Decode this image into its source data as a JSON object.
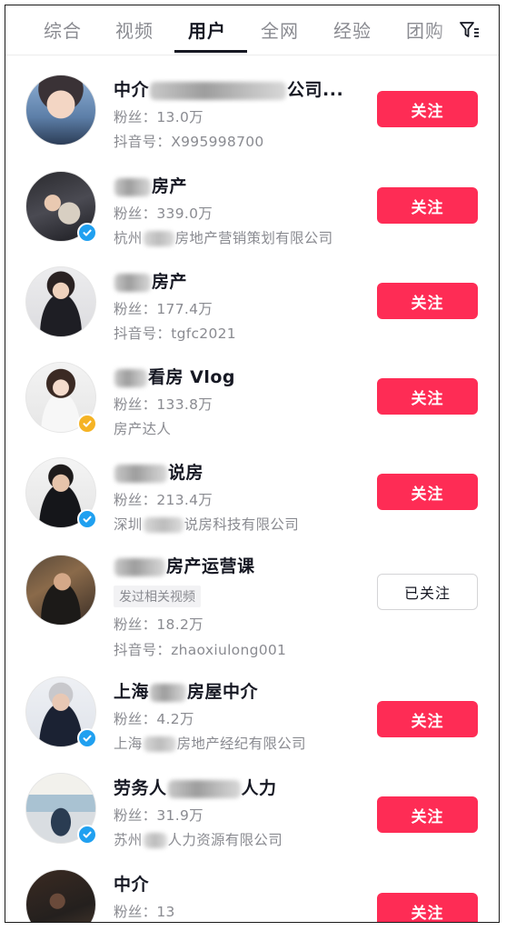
{
  "tabs": [
    {
      "label": "综合"
    },
    {
      "label": "视频"
    },
    {
      "label": "用户",
      "active": true
    },
    {
      "label": "全网"
    },
    {
      "label": "经验"
    },
    {
      "label": "团购"
    }
  ],
  "follow_label": "关注",
  "followed_label": "已关注",
  "users": [
    {
      "name_pre": "中介",
      "name_post": "公司...",
      "fans": "粉丝：13.0万",
      "sub_pre": "抖音号：X995998700",
      "sub_post": "",
      "verified": "none",
      "following": false
    },
    {
      "name_pre": "",
      "name_post": "房产",
      "fans": "粉丝：339.0万",
      "sub_pre": "杭州",
      "sub_post": "房地产营销策划有限公司",
      "verified": "blue",
      "following": false
    },
    {
      "name_pre": "",
      "name_post": "房产",
      "fans": "粉丝：177.4万",
      "sub_pre": "抖音号：tgfc2021",
      "sub_post": "",
      "verified": "none",
      "following": false
    },
    {
      "name_pre": "",
      "name_post": "看房 Vlog",
      "fans": "粉丝：133.8万",
      "sub_pre": "房产达人",
      "sub_post": "",
      "verified": "yellow",
      "following": false
    },
    {
      "name_pre": "",
      "name_post": "说房",
      "fans": "粉丝：213.4万",
      "sub_pre": "深圳",
      "sub_post": "说房科技有限公司",
      "verified": "blue",
      "following": false
    },
    {
      "name_pre": "",
      "name_post": "房产运营课",
      "tag": "发过相关视频",
      "fans": "粉丝：18.2万",
      "sub_pre": "抖音号：zhaoxiulong001",
      "sub_post": "",
      "verified": "none",
      "following": true
    },
    {
      "name_pre": "上海",
      "name_post": "房屋中介",
      "fans": "粉丝：4.2万",
      "sub_pre": "上海",
      "sub_post": "房地产经纪有限公司",
      "verified": "blue",
      "following": false
    },
    {
      "name_pre": "劳务人",
      "name_post": "人力",
      "fans": "粉丝：31.9万",
      "sub_pre": "苏州",
      "sub_post": "人力资源有限公司",
      "verified": "blue",
      "following": false
    },
    {
      "name_pre": "中介",
      "name_post": "",
      "fans": "粉丝：13",
      "sub_pre": "",
      "sub_post": "",
      "verified": "none",
      "following": false
    }
  ],
  "colors": {
    "accent": "#fe2c55",
    "verified_blue": "#20a0f0",
    "verified_yellow": "#f5b324"
  }
}
